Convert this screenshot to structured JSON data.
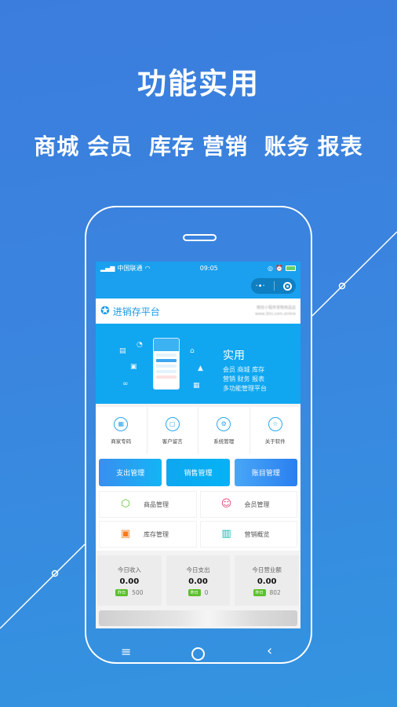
{
  "promo": {
    "headline": "功能实用",
    "features": [
      "商城",
      "会员",
      "库存",
      "营销",
      "账务",
      "报表"
    ]
  },
  "status_bar": {
    "carrier": "中国联通",
    "time": "09:05"
  },
  "app": {
    "brand_name": "进销存平台",
    "brand_note_line1": "微信小程序宠物用品店",
    "brand_note_line2": "www.3mi.com.online"
  },
  "banner": {
    "title": "实用",
    "lines": [
      "会员  商城  库存",
      "营销  财务  报表",
      "多功能管理平台"
    ]
  },
  "quick_actions": [
    {
      "label": "商家专码",
      "icon": "qr-code-icon",
      "glyph": "▦"
    },
    {
      "label": "客户留言",
      "icon": "message-icon",
      "glyph": "▢"
    },
    {
      "label": "系统管理",
      "icon": "settings-icon",
      "glyph": "⚙"
    },
    {
      "label": "关于软件",
      "icon": "star-icon",
      "glyph": "☆"
    }
  ],
  "action_buttons": [
    {
      "label": "支出管理"
    },
    {
      "label": "销售管理"
    },
    {
      "label": "账目管理"
    }
  ],
  "management": [
    {
      "label": "商品管理",
      "icon": "cube-icon",
      "glyph": "⬡",
      "color": "#5cc02d"
    },
    {
      "label": "会员管理",
      "icon": "members-icon",
      "glyph": "☺",
      "color": "#e8467c"
    },
    {
      "label": "库存管理",
      "icon": "inventory-icon",
      "glyph": "▣",
      "color": "#f57a1f"
    },
    {
      "label": "营销概览",
      "icon": "chart-icon",
      "glyph": "▥",
      "color": "#19b7b0"
    }
  ],
  "stats": [
    {
      "title": "今日收入",
      "value": "0.00",
      "badge": "昨日",
      "compare": "500"
    },
    {
      "title": "今日支出",
      "value": "0.00",
      "badge": "昨日",
      "compare": "0"
    },
    {
      "title": "今日营业额",
      "value": "0.00",
      "badge": "昨日",
      "compare": "802"
    }
  ],
  "system_nav": {
    "menu": "≡",
    "back": "‹"
  },
  "colors": {
    "background": "#3a85df",
    "app_primary": "#1aa0ee",
    "banner": "#10a7f0",
    "badge_green": "#5cc02d"
  }
}
